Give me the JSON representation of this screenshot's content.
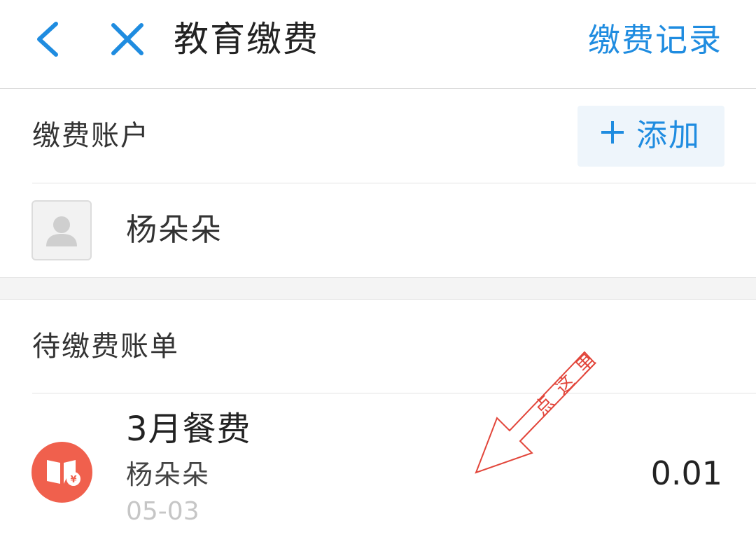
{
  "header": {
    "title": "教育缴费",
    "history_link": "缴费记录"
  },
  "account_section": {
    "label": "缴费账户",
    "add_button_label": "添加",
    "accounts": [
      {
        "name": "杨朵朵"
      }
    ]
  },
  "bills_section": {
    "label": "待缴费账单",
    "bills": [
      {
        "title": "3月餐费",
        "payer": "杨朵朵",
        "date": "05-03",
        "amount": "0.01"
      }
    ]
  },
  "annotation": {
    "text": "点这里",
    "color": "#e2453a"
  },
  "colors": {
    "accent": "#1f8ce0",
    "bill_icon": "#f0604d"
  },
  "icons": {
    "back": "chevron-left-icon",
    "close": "close-icon",
    "add": "plus-icon",
    "avatar": "user-placeholder-icon",
    "bill": "book-yuan-icon"
  }
}
